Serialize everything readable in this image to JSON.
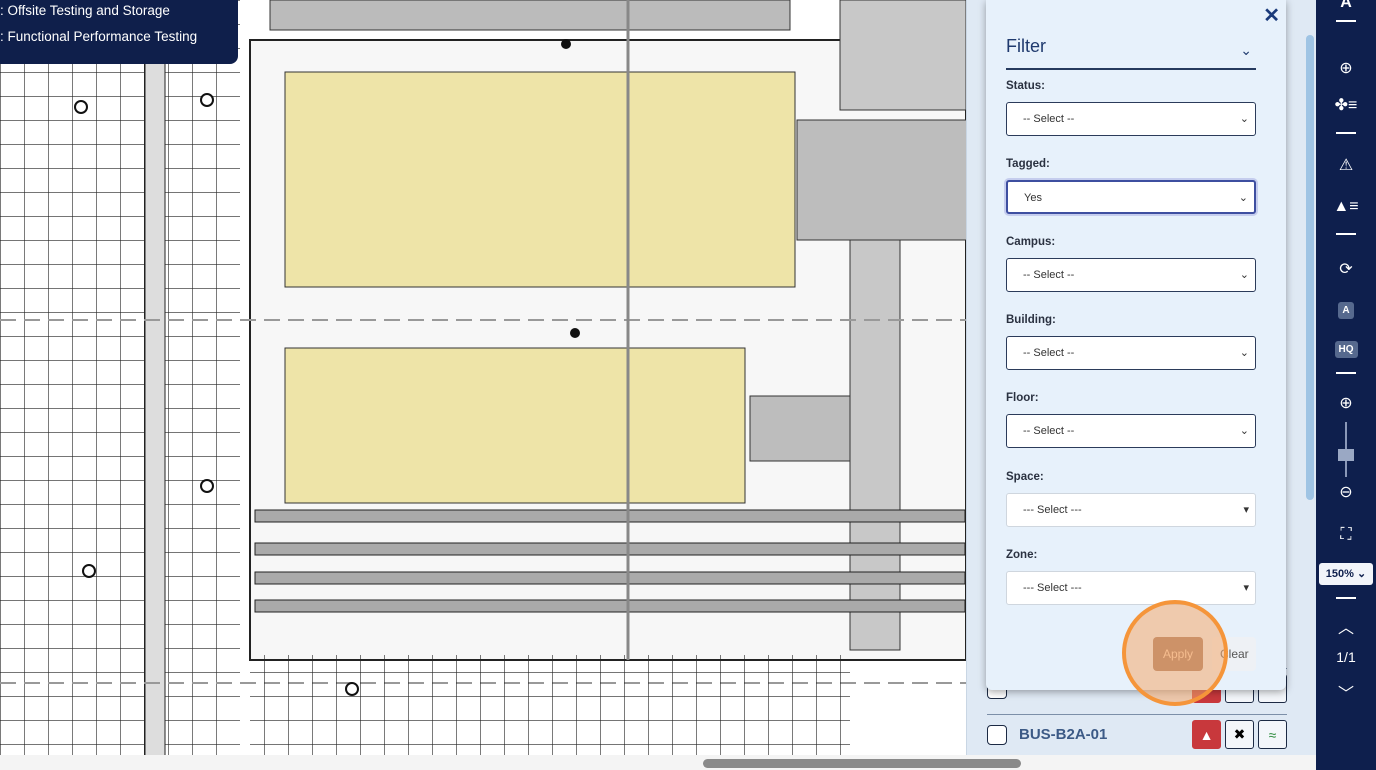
{
  "legend": {
    "items": [
      ": Offsite Testing and Storage",
      ": Functional Performance Testing"
    ]
  },
  "filter": {
    "title": "Filter",
    "fields": [
      {
        "label": "Status:",
        "value": "-- Select --"
      },
      {
        "label": "Tagged:",
        "value": "Yes"
      },
      {
        "label": "Campus:",
        "value": "-- Select --"
      },
      {
        "label": "Building:",
        "value": "-- Select --"
      },
      {
        "label": "Floor:",
        "value": "-- Select --"
      },
      {
        "label": "Space:",
        "value": "--- Select ---"
      },
      {
        "label": "Zone:",
        "value": "--- Select ---"
      }
    ],
    "apply_label": "Apply",
    "clear_label": "Clear"
  },
  "list": {
    "items": [
      {
        "label": ""
      },
      {
        "label": "BUS-B2A-01"
      }
    ]
  },
  "rail": {
    "zoom_level": "150%",
    "page": "1/1",
    "top_label": "A",
    "rotate_label": "A",
    "hq_label": "HQ"
  },
  "colors": {
    "rail": "#0e1f4d",
    "filter_bg": "#e7f1fb",
    "highlight": "#f5953a",
    "equipment": "#eee4a8",
    "alert": "#c8383c"
  }
}
